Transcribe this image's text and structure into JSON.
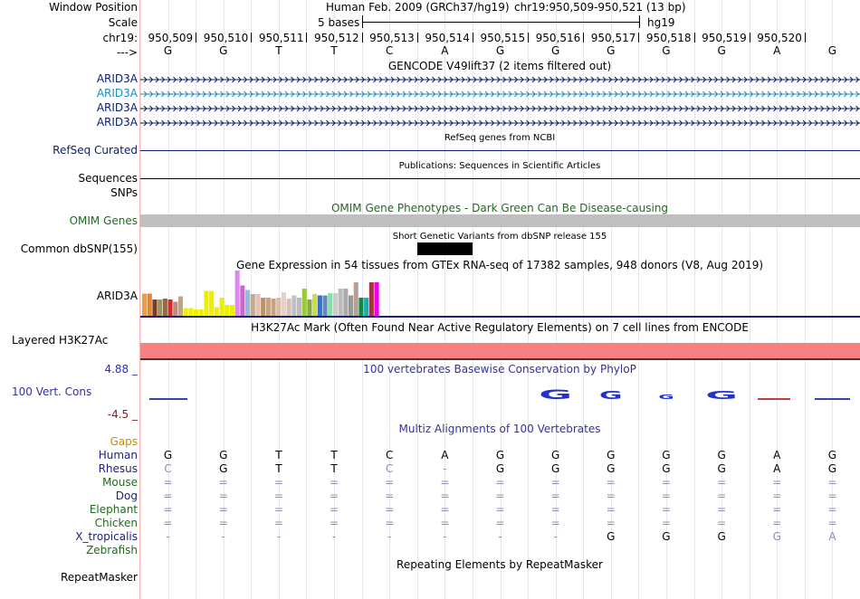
{
  "window_position": {
    "label": "Window Position",
    "assembly": "Human Feb. 2009 (GRCh37/hg19)",
    "range": "chr19:950,509-950,521 (13 bp)"
  },
  "scale": {
    "label": "Scale",
    "bar_text": "5 bases",
    "assembly": "hg19"
  },
  "ruler": {
    "label": "chr19:",
    "positions": [
      "950,509",
      "950,510",
      "950,511",
      "950,512",
      "950,513",
      "950,514",
      "950,515",
      "950,516",
      "950,517",
      "950,518",
      "950,519",
      "950,520"
    ]
  },
  "strand": {
    "label": "--->"
  },
  "bases": [
    "G",
    "G",
    "T",
    "T",
    "C",
    "A",
    "G",
    "G",
    "G",
    "G",
    "G",
    "A",
    "G"
  ],
  "gencode": {
    "title": "GENCODE V49lift37 (2 items filtered out)",
    "genes": [
      {
        "label": "ARID3A",
        "color": "#0a1f6b"
      },
      {
        "label": "ARID3A",
        "color": "#1e8cbe"
      },
      {
        "label": "ARID3A",
        "color": "#0a1f6b"
      },
      {
        "label": "ARID3A",
        "color": "#0a1f6b"
      }
    ]
  },
  "refseq": {
    "label": "RefSeq Curated",
    "title": "RefSeq genes from NCBI"
  },
  "publications": {
    "label": "Sequences",
    "title": "Publications: Sequences in Scientific Articles"
  },
  "snps": {
    "label": "SNPs"
  },
  "omim": {
    "label": "OMIM Genes",
    "title": "OMIM Gene Phenotypes - Dark Green Can Be Disease-causing"
  },
  "dbsnp": {
    "label": "Common dbSNP(155)",
    "title": "Short Genetic Variants from dbSNP release 155"
  },
  "gtex": {
    "label": "ARID3A",
    "title": "Gene Expression in 54 tissues from GTEx RNA-seq of 17382 samples, 948 donors (V8, Aug 2019)",
    "bars": [
      {
        "c": "#f29b3a",
        "v": 0.49
      },
      {
        "c": "#e8862f",
        "v": 0.49
      },
      {
        "c": "#7c3a1f",
        "v": 0.36
      },
      {
        "c": "#a0906d",
        "v": 0.36
      },
      {
        "c": "#8b6d4a",
        "v": 0.38
      },
      {
        "c": "#d22b2b",
        "v": 0.36
      },
      {
        "c": "#c08a7a",
        "v": 0.31
      },
      {
        "c": "#c4a47c",
        "v": 0.43
      },
      {
        "c": "#eeee00",
        "v": 0.17
      },
      {
        "c": "#eeee00",
        "v": 0.17
      },
      {
        "c": "#eeee00",
        "v": 0.14
      },
      {
        "c": "#eeee00",
        "v": 0.14
      },
      {
        "c": "#eeee00",
        "v": 0.55
      },
      {
        "c": "#eeee00",
        "v": 0.55
      },
      {
        "c": "#eeee00",
        "v": 0.19
      },
      {
        "c": "#eeee00",
        "v": 0.4
      },
      {
        "c": "#eeee00",
        "v": 0.24
      },
      {
        "c": "#eeee00",
        "v": 0.24
      },
      {
        "c": "#dd88ee",
        "v": 1.0
      },
      {
        "c": "#cc66cc",
        "v": 0.67
      },
      {
        "c": "#8fbce0",
        "v": 0.57
      },
      {
        "c": "#c8a88c",
        "v": 0.48
      },
      {
        "c": "#e6c0b0",
        "v": 0.48
      },
      {
        "c": "#b8956c",
        "v": 0.4
      },
      {
        "c": "#c4a484",
        "v": 0.4
      },
      {
        "c": "#c4a484",
        "v": 0.38
      },
      {
        "c": "#dbbfa0",
        "v": 0.4
      },
      {
        "c": "#e8d0c8",
        "v": 0.52
      },
      {
        "c": "#d8c0b8",
        "v": 0.38
      },
      {
        "c": "#c0c0c0",
        "v": 0.45
      },
      {
        "c": "#bcbcbc",
        "v": 0.4
      },
      {
        "c": "#99cc33",
        "v": 0.6
      },
      {
        "c": "#88aa44",
        "v": 0.36
      },
      {
        "c": "#ccdd44",
        "v": 0.48
      },
      {
        "c": "#2e6fd8",
        "v": 0.45
      },
      {
        "c": "#6688bb",
        "v": 0.45
      },
      {
        "c": "#88ddaa",
        "v": 0.5
      },
      {
        "c": "#cccccc",
        "v": 0.5
      },
      {
        "c": "#bbbbbb",
        "v": 0.6
      },
      {
        "c": "#aaaaaa",
        "v": 0.6
      },
      {
        "c": "#999999",
        "v": 0.45
      },
      {
        "c": "#b8a090",
        "v": 0.74
      },
      {
        "c": "#118844",
        "v": 0.4
      },
      {
        "c": "#22aaaa",
        "v": 0.4
      },
      {
        "c": "#aa3344",
        "v": 0.74
      },
      {
        "c": "#ee00ee",
        "v": 0.74
      }
    ]
  },
  "h3k27ac": {
    "label": "Layered H3K27Ac",
    "title": "H3K27Ac Mark (Often Found Near Active Regulatory Elements) on 7 cell lines from ENCODE"
  },
  "conservation": {
    "label": "100 Vert. Cons",
    "title": "100 vertebrates Basewise Conservation by PhyloP",
    "ymax": "4.88 _",
    "ymin": "-4.5 _",
    "logo_letters": [
      "G",
      "G",
      "G",
      "G"
    ]
  },
  "multiz": {
    "title": "Multiz Alignments of 100 Vertebrates",
    "gaps_label": "Gaps",
    "species": [
      {
        "label": "Human",
        "color": "#1f1f7a",
        "row": [
          "G",
          "G",
          "T",
          "T",
          "C",
          "A",
          "G",
          "G",
          "G",
          "G",
          "G",
          "A",
          "G"
        ]
      },
      {
        "label": "Rhesus",
        "color": "#1f1f7a",
        "row": [
          "C",
          "G",
          "T",
          "T",
          "C",
          "-",
          "G",
          "G",
          "G",
          "G",
          "G",
          "A",
          "G"
        ]
      },
      {
        "label": "Mouse",
        "color": "#1f6b1f",
        "row": [
          "=",
          "=",
          "=",
          "=",
          "=",
          "=",
          "=",
          "=",
          "=",
          "=",
          "=",
          "=",
          "="
        ]
      },
      {
        "label": "Dog",
        "color": "#1f1f7a",
        "row": [
          "=",
          "=",
          "=",
          "=",
          "=",
          "=",
          "=",
          "=",
          "=",
          "=",
          "=",
          "=",
          "="
        ]
      },
      {
        "label": "Elephant",
        "color": "#1f6b1f",
        "row": [
          "=",
          "=",
          "=",
          "=",
          "=",
          "=",
          "=",
          "=",
          "=",
          "=",
          "=",
          "=",
          "="
        ]
      },
      {
        "label": "Chicken",
        "color": "#1f6b1f",
        "row": [
          "=",
          "=",
          "=",
          "=",
          "=",
          "=",
          "=",
          "=",
          "=",
          "=",
          "=",
          "=",
          "="
        ]
      },
      {
        "label": "X_tropicalis",
        "color": "#1f1f7a",
        "row": [
          "-",
          "-",
          "-",
          "-",
          "-",
          "-",
          "-",
          "-",
          "G",
          "G",
          "G",
          "G",
          "A"
        ]
      },
      {
        "label": "Zebrafish",
        "color": "#1f6b1f",
        "row": [
          "",
          "",
          "",
          "",
          "",
          "",
          "",
          "",
          "",
          "",
          "",
          "",
          ""
        ]
      }
    ]
  },
  "repeatmasker": {
    "label": "RepeatMasker",
    "title": "Repeating Elements by RepeatMasker"
  },
  "colors": {
    "nav_blue": "#0a1f6b",
    "omim_gray": "#bfbfbf",
    "h3k27ac_pink": "#f88080",
    "h3k27ac_dark": "#7a1f1f"
  }
}
